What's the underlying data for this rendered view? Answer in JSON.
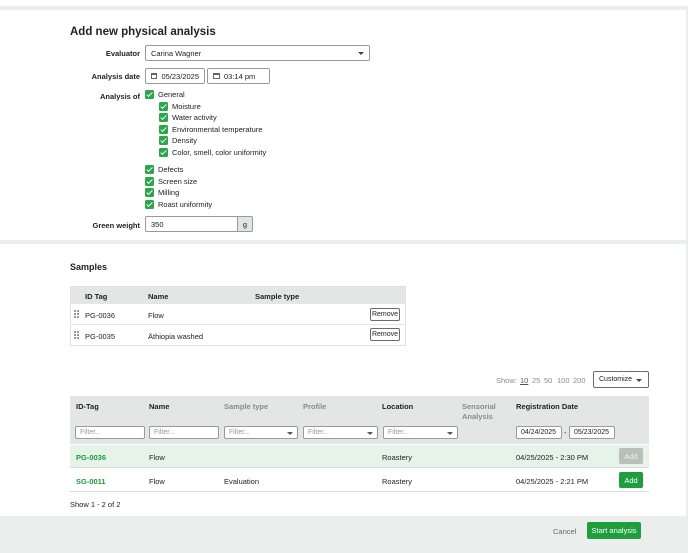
{
  "form": {
    "title": "Add new physical analysis",
    "evaluator": {
      "label": "Evaluator",
      "value": "Carina Wagner"
    },
    "analysis_date": {
      "label": "Analysis date",
      "date": "05/23/2025",
      "time": "03:14 pm"
    },
    "analysis_of": {
      "label": "Analysis of",
      "general": "General",
      "sub_items": [
        "Moisture",
        "Water activity",
        "Environmental temperature",
        "Density",
        "Color, smell, color uniformity"
      ],
      "other_items": [
        "Defects",
        "Screen size",
        "Milling",
        "Roast uniformity"
      ]
    },
    "green_weight": {
      "label": "Green weight",
      "value": "350",
      "unit": "g"
    }
  },
  "samples": {
    "title": "Samples",
    "headers": [
      "ID Tag",
      "Name",
      "Sample type"
    ],
    "rows": [
      {
        "id": "PG-0036",
        "name": "Flow",
        "type": "",
        "action": "Remove"
      },
      {
        "id": "PG-0035",
        "name": "Äthiopia washed",
        "type": "",
        "action": "Remove"
      }
    ]
  },
  "table": {
    "show_label": "Show:",
    "page_sizes": [
      "10",
      "25",
      "50",
      "100",
      "200"
    ],
    "selected_page_size": "10",
    "customize_label": "Customize",
    "headers": {
      "id_tag": "ID-Tag",
      "name": "Name",
      "sample_type": "Sample type",
      "profile": "Profile",
      "location": "Location",
      "sensorial_line1": "Sensorial",
      "sensorial_line2": "Analysis",
      "registration_date": "Registration Date"
    },
    "filter_placeholder": "Filter...",
    "date_from": "04/24/2025",
    "date_sep": "-",
    "date_to": "05/23/2025",
    "rows": [
      {
        "id": "PG-0036",
        "name": "Flow",
        "sample_type": "",
        "location": "Roastery",
        "date": "04/25/2025 - 2:30 PM",
        "action": "Add",
        "added": true
      },
      {
        "id": "SG-0011",
        "name": "Flow",
        "sample_type": "Evaluation",
        "location": "Roastery",
        "date": "04/25/2025 - 2:21 PM",
        "action": "Add",
        "added": false
      }
    ],
    "footer": "Show 1 - 2 of 2"
  },
  "footer": {
    "cancel": "Cancel",
    "start": "Start analysis"
  },
  "colors": {
    "accent": "#1f9d3f",
    "row_highlight": "#e6f3e8",
    "header_bg": "#e4e6e5",
    "page_bg": "#eceeed"
  }
}
